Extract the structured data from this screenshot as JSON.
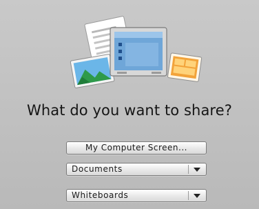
{
  "title": "What do you want to share?",
  "buttons": {
    "my_computer_screen_label": "My Computer Screen..."
  },
  "dropdowns": {
    "documents": {
      "selected": "Documents",
      "icon": "chevron-down-icon"
    },
    "whiteboards": {
      "selected": "Whiteboards",
      "icon": "chevron-down-icon"
    }
  },
  "illustration": {
    "icons": [
      "document-icon",
      "photo-icon",
      "screen-window-icon",
      "whiteboard-icon"
    ]
  },
  "colors": {
    "background": "#c2c2c2",
    "window_blue": "#6fa6d8",
    "whiteboard_orange": "#f2a33a",
    "photo_green": "#3aa55a"
  }
}
